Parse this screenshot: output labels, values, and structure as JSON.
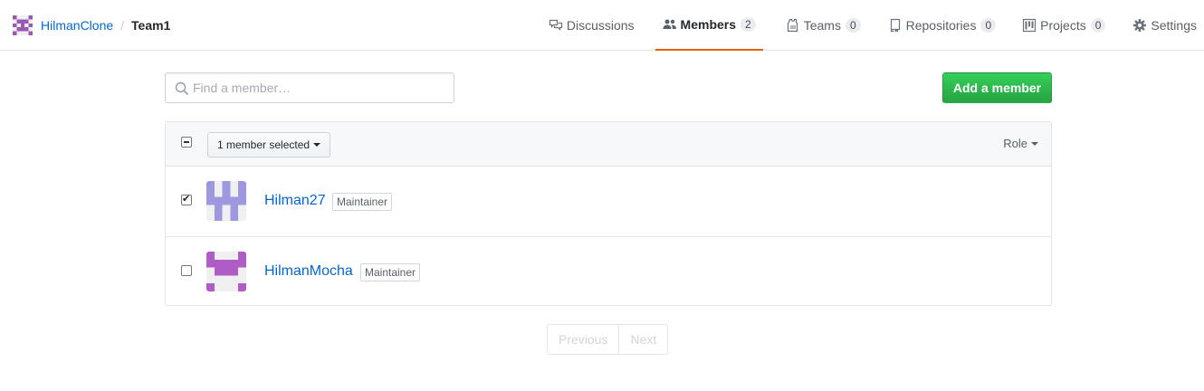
{
  "header": {
    "org_name": "HilmanClone",
    "separator": "/",
    "team_name": "Team1"
  },
  "tabs": [
    {
      "label": "Discussions",
      "icon": "comment-discussion-icon",
      "counter": null,
      "selected": false
    },
    {
      "label": "Members",
      "icon": "people-icon",
      "counter": "2",
      "selected": true
    },
    {
      "label": "Teams",
      "icon": "jersey-icon",
      "counter": "0",
      "selected": false
    },
    {
      "label": "Repositories",
      "icon": "repo-icon",
      "counter": "0",
      "selected": false
    },
    {
      "label": "Projects",
      "icon": "project-icon",
      "counter": "0",
      "selected": false
    },
    {
      "label": "Settings",
      "icon": "gear-icon",
      "counter": null,
      "selected": false
    }
  ],
  "search": {
    "placeholder": "Find a member…",
    "value": ""
  },
  "add_member_label": "Add a member",
  "toolbar": {
    "select_all_state": "mixed",
    "selection_label": "1 member selected",
    "role_filter_label": "Role"
  },
  "members": [
    {
      "name": "Hilman27",
      "role": "Maintainer",
      "checked": true
    },
    {
      "name": "HilmanMocha",
      "role": "Maintainer",
      "checked": false
    }
  ],
  "pagination": {
    "previous_label": "Previous",
    "next_label": "Next"
  },
  "colors": {
    "link": "#0366d6",
    "primary_button": "#28a745",
    "selected_tab_underline": "#e36209",
    "org_avatar": "#9b59b6",
    "member1_avatar": "#9d98e0",
    "member2_avatar": "#b05cc6"
  }
}
